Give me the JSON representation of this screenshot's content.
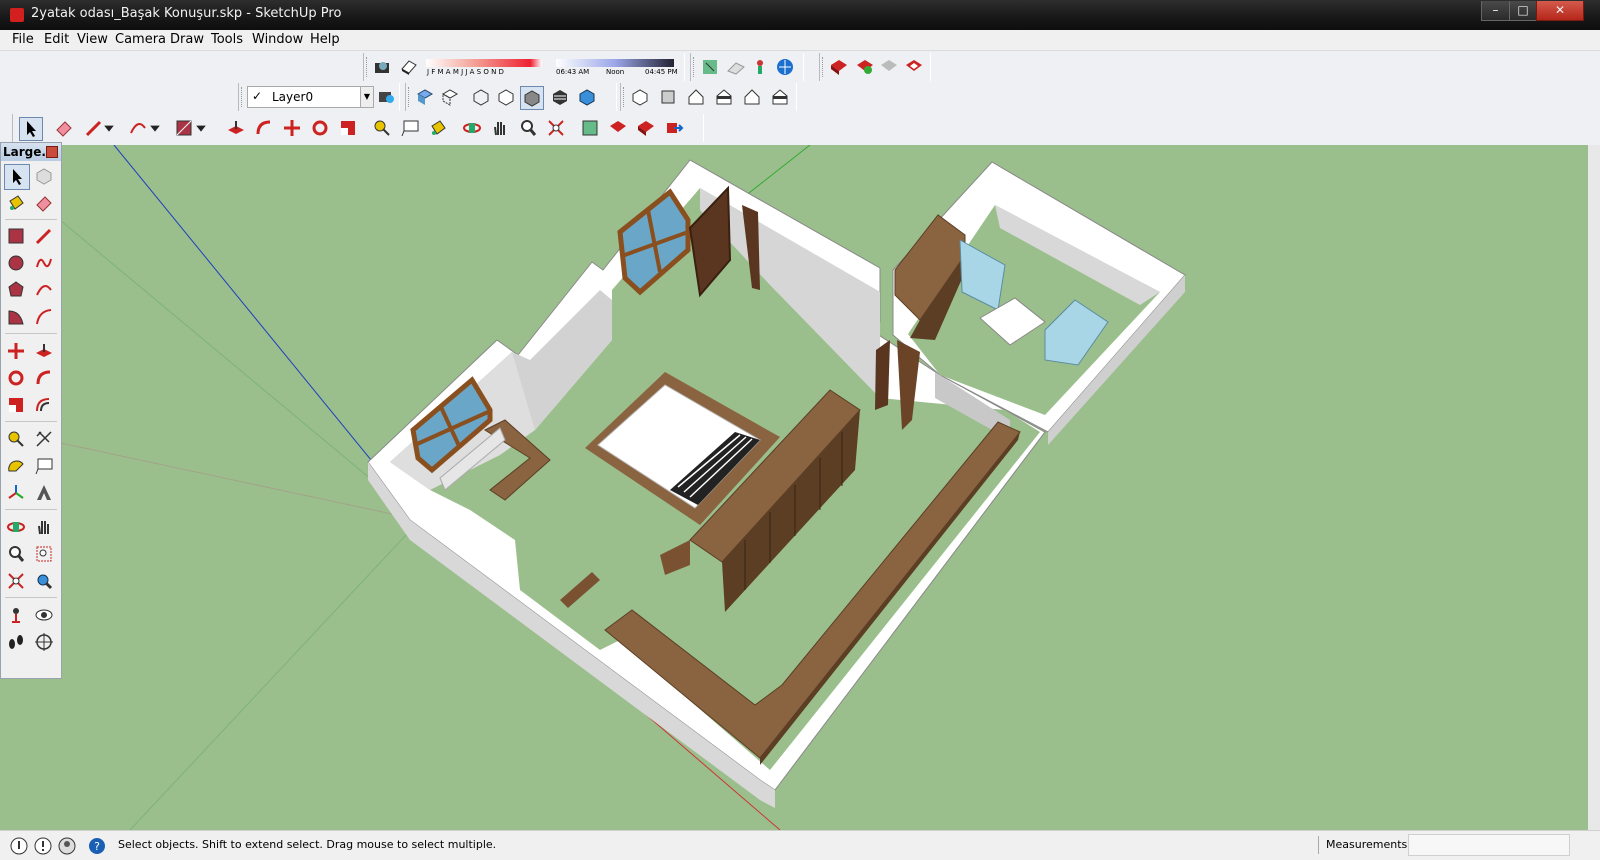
{
  "window": {
    "title": "2yatak odası_Başak Konuşur.skp - SketchUp Pro",
    "controls": [
      "minimize",
      "maximize",
      "close"
    ]
  },
  "menu": [
    "File",
    "Edit",
    "View",
    "Camera",
    "Draw",
    "Tools",
    "Window",
    "Help"
  ],
  "shadow_settings": {
    "months": "J F M A M J J A S O N D",
    "time_start": "06:43 AM",
    "time_noon": "Noon",
    "time_end": "04:45 PM"
  },
  "layers": {
    "current": "Layer0",
    "checkmark": "✓"
  },
  "large_toolset": {
    "title": "Large...",
    "tools": [
      "select-icon",
      "component-icon",
      "paint-bucket-icon",
      "eraser-icon",
      "rectangle-icon",
      "line-icon",
      "circle-icon",
      "freehand-icon",
      "polygon-icon",
      "arc-icon",
      "pie-icon",
      "two-point-arc-icon",
      "move-icon",
      "push-pull-icon",
      "rotate-icon",
      "follow-me-icon",
      "scale-icon",
      "offset-icon",
      "tape-measure-icon",
      "dimension-icon",
      "protractor-icon",
      "text-icon",
      "axes-icon",
      "3d-text-icon",
      "orbit-icon",
      "pan-icon",
      "zoom-icon",
      "zoom-window-icon",
      "zoom-extents-icon",
      "previous-view-icon",
      "position-camera-icon",
      "look-around-icon",
      "walk-icon",
      "section-plane-icon"
    ]
  },
  "status": {
    "hint": "Select objects. Shift to extend select. Drag mouse to select multiple.",
    "measurements_label": "Measurements",
    "measurements_value": ""
  },
  "colors": {
    "ground": "#9bbf8c",
    "wall_top": "#ffffff",
    "wall_side": "#dcdcdc",
    "floor": "#9bbf8c",
    "wood": "#8a6440",
    "wood_dark": "#5b3e24",
    "glass": "#6aa6c8"
  }
}
